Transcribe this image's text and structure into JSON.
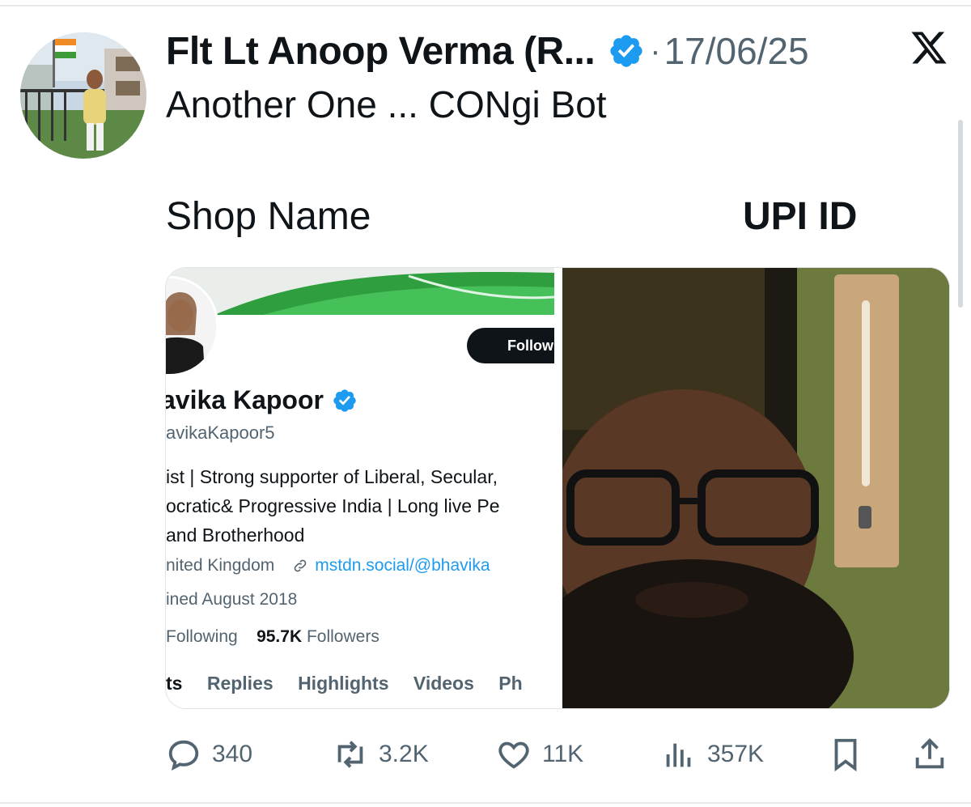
{
  "tweet": {
    "author_name": "Flt Lt Anoop Verma (R...",
    "separator": "·",
    "date": "17/06/25",
    "text": "Another One ... CONgi Bot",
    "label_left": "Shop Name",
    "label_right": "UPI ID"
  },
  "embedded_profile": {
    "follow_label": "Follow",
    "name": "avika Kapoor",
    "handle": "avikaKapoor5",
    "bio_lines": [
      "ist | Strong supporter of Liberal, Secular,",
      "ocratic& Progressive India | Long live Pe",
      " and Brotherhood"
    ],
    "location": "nited Kingdom",
    "link": "mstdn.social/@bhavika",
    "joined": "ined August 2018",
    "following_label": "Following",
    "followers_count": "95.7K",
    "followers_label": "Followers",
    "tabs": [
      "ts",
      "Replies",
      "Highlights",
      "Videos",
      "Ph"
    ]
  },
  "actions": {
    "replies": "340",
    "reposts": "3.2K",
    "likes": "11K",
    "views": "357K"
  },
  "icons": {
    "verified": "verified-badge-icon",
    "platform": "x-logo-icon",
    "reply": "reply-icon",
    "repost": "repost-icon",
    "like": "heart-icon",
    "views": "views-icon",
    "bookmark": "bookmark-icon",
    "share": "share-icon",
    "link": "link-icon"
  },
  "colors": {
    "accent": "#1d9bf0",
    "text": "#0f1419",
    "muted": "#536471"
  }
}
